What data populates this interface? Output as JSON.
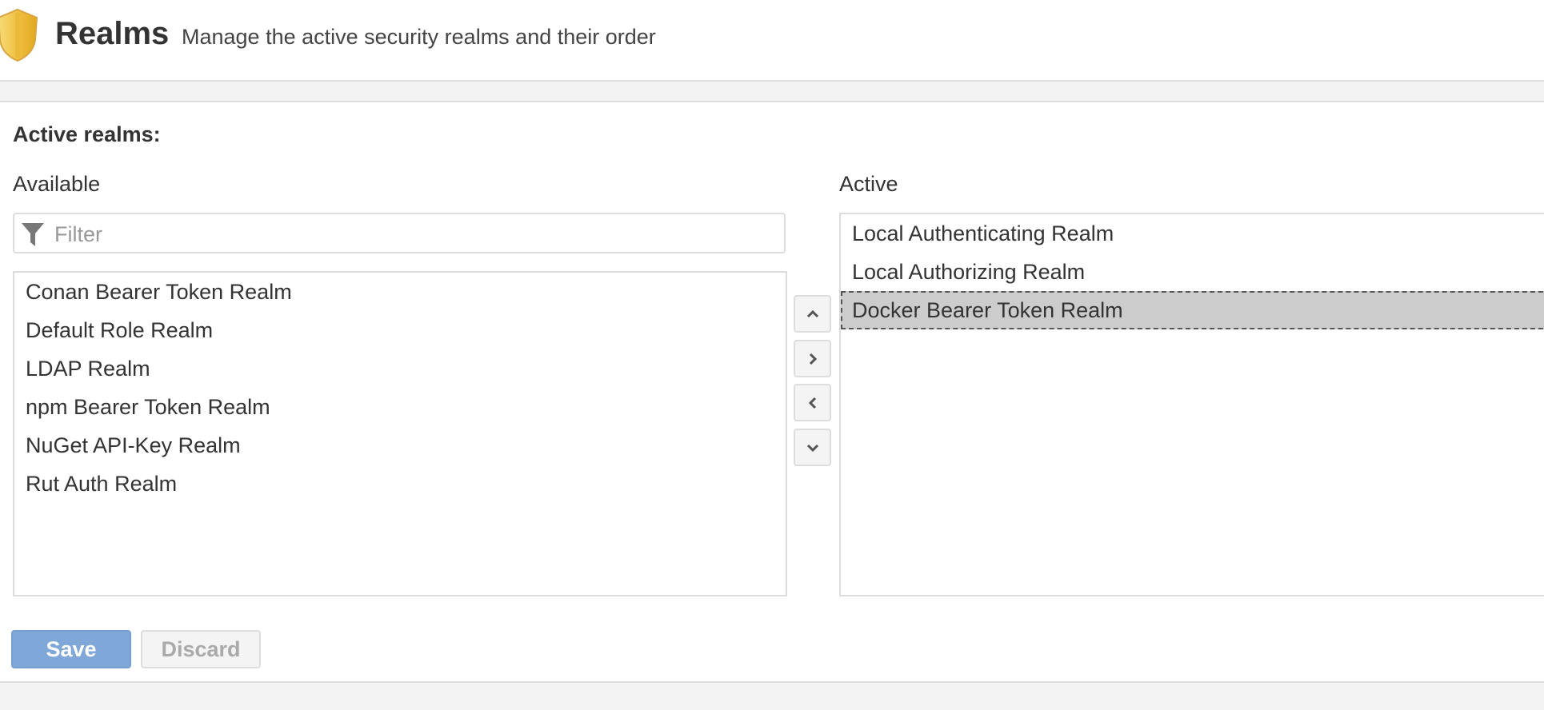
{
  "header": {
    "icon": "shield-icon",
    "title": "Realms",
    "subtitle": "Manage the active security realms and their order"
  },
  "section_title": "Active realms:",
  "available": {
    "label": "Available",
    "filter_placeholder": "Filter",
    "filter_value": "",
    "items": [
      "Conan Bearer Token Realm",
      "Default Role Realm",
      "LDAP Realm",
      "npm Bearer Token Realm",
      "NuGet API-Key Realm",
      "Rut Auth Realm"
    ]
  },
  "active": {
    "label": "Active",
    "items": [
      "Local Authenticating Realm",
      "Local Authorizing Realm",
      "Docker Bearer Token Realm"
    ],
    "selected": "Docker Bearer Token Realm"
  },
  "move_buttons": [
    "chevron-up-icon",
    "chevron-right-icon",
    "chevron-left-icon",
    "chevron-down-icon"
  ],
  "actions": {
    "save": "Save",
    "discard": "Discard"
  },
  "colors": {
    "save": "#7fa7d8",
    "shield": "#f2c94c",
    "selected": "#cccccc"
  }
}
